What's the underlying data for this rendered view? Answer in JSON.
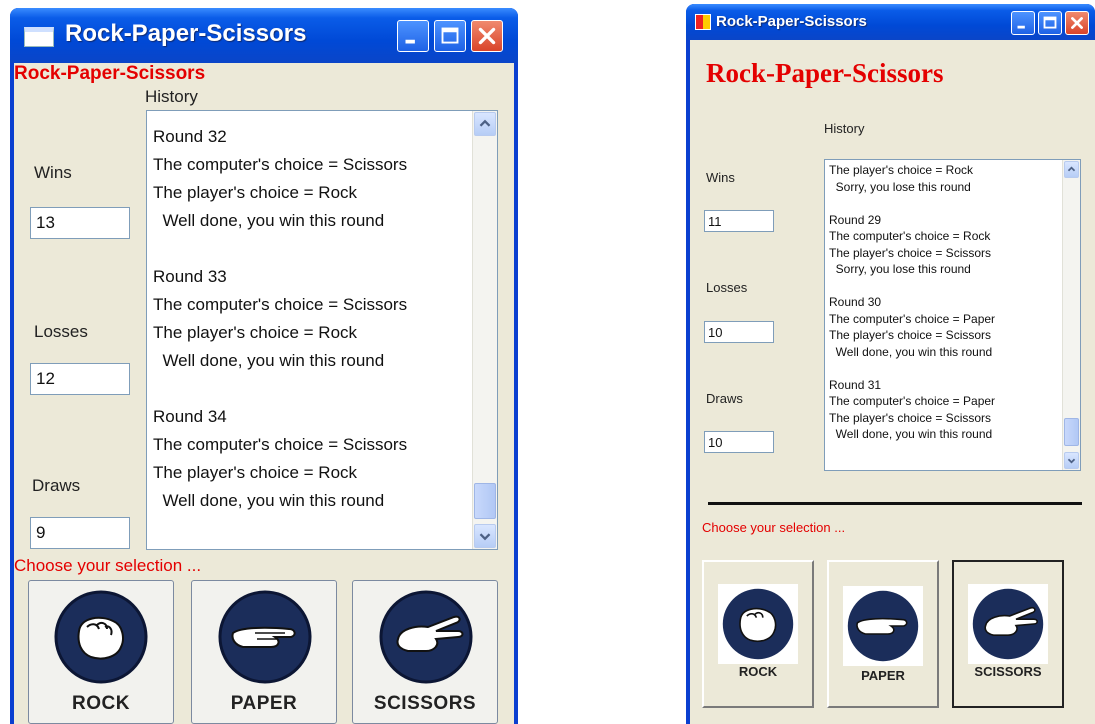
{
  "windows": [
    {
      "title": "Rock-Paper-Scissors",
      "heading": "Rock-Paper-Scissors",
      "history_label": "History",
      "wins_label": "Wins",
      "wins_value": "13",
      "losses_label": "Losses",
      "losses_value": "12",
      "draws_label": "Draws",
      "draws_value": "9",
      "history_lines": [
        "Round 32",
        "The computer's choice = Scissors",
        "The player's choice = Rock",
        "  Well done, you win this round",
        "",
        "Round 33",
        "The computer's choice = Scissors",
        "The player's choice = Rock",
        "  Well done, you win this round",
        "",
        "Round 34",
        "The computer's choice = Scissors",
        "The player's choice = Rock",
        "  Well done, you win this round"
      ],
      "prompt": "Choose your selection ...",
      "buttons": [
        "ROCK",
        "PAPER",
        "SCISSORS"
      ]
    },
    {
      "title": "Rock-Paper-Scissors",
      "heading": "Rock-Paper-Scissors",
      "history_label": "History",
      "wins_label": "Wins",
      "wins_value": "11",
      "losses_label": "Losses",
      "losses_value": "10",
      "draws_label": "Draws",
      "draws_value": "10",
      "history_lines": [
        "The player's choice = Rock",
        "  Sorry, you lose this round",
        "",
        "Round 29",
        "The computer's choice = Rock",
        "The player's choice = Scissors",
        "  Sorry, you lose this round",
        "",
        "Round 30",
        "The computer's choice = Paper",
        "The player's choice = Scissors",
        "  Well done, you win this round",
        "",
        "Round 31",
        "The computer's choice = Paper",
        "The player's choice = Scissors",
        "  Well done, you win this round"
      ],
      "prompt": "Choose your selection ...",
      "buttons": [
        "ROCK",
        "PAPER",
        "SCISSORS"
      ]
    }
  ],
  "colors": {
    "accent_red": "#e40000",
    "xp_blue": "#0a49d6",
    "face": "#ece9d8"
  },
  "icons": [
    "app-window-icon",
    "minimize-icon",
    "maximize-icon",
    "close-icon",
    "scroll-up-icon",
    "scroll-down-icon",
    "rock-fist-icon",
    "paper-hand-icon",
    "scissors-hand-icon"
  ]
}
